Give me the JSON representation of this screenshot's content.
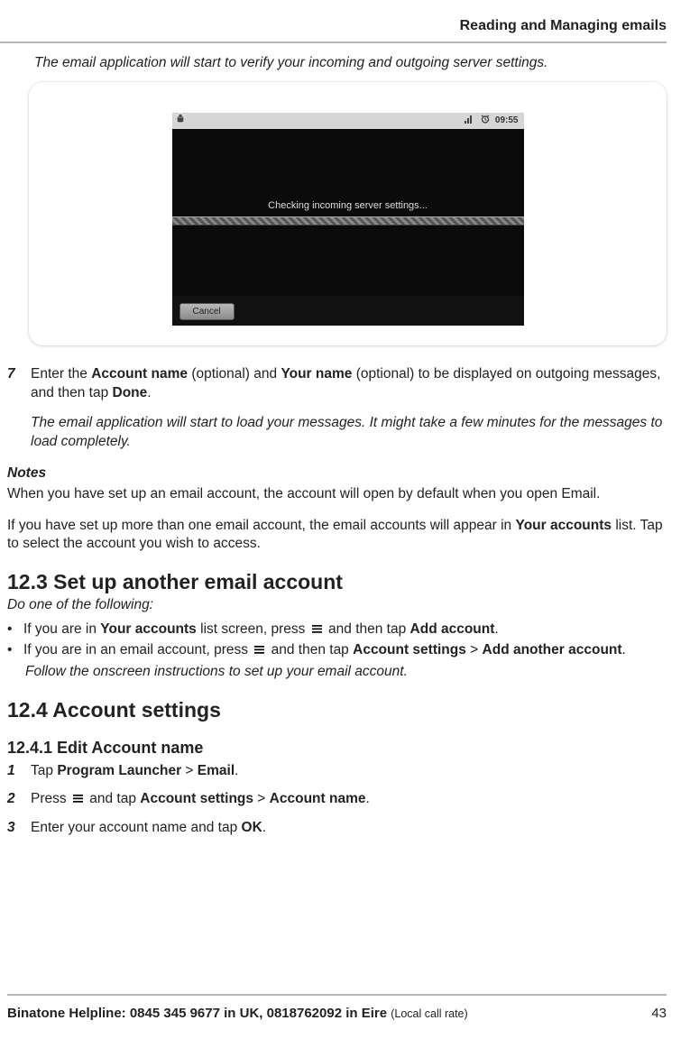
{
  "header": "Reading and Managing emails",
  "intro": "The email application will start to verify your incoming and outgoing server settings.",
  "screenshot": {
    "clock": "09:55",
    "message": "Checking incoming server settings...",
    "cancel": "Cancel"
  },
  "step7": {
    "num": "7",
    "text_pre": "Enter the ",
    "b1": "Account name",
    "text_mid1": " (optional) and ",
    "b2": "Your name",
    "text_mid2": " (optional) to be displayed on outgoing messages, and then tap ",
    "b3": "Done",
    "text_end": ".",
    "note": "The email application will start to load your messages. It might take a few minutes for the messages to load completely."
  },
  "notes": {
    "label": "Notes",
    "p1": "When you have set up an email account, the account will open by default when you open Email.",
    "p2_pre": "If you have set up more than one email account, the email accounts will appear in ",
    "p2_b": "Your accounts",
    "p2_post": " list. Tap to select the account you wish to access."
  },
  "s12_3": {
    "title": "12.3   Set up another email account",
    "sub": "Do one of the following:",
    "b1": {
      "pre": "If you are in ",
      "b1": "Your accounts",
      "mid": " list screen, press ",
      "post_pre": " and then tap ",
      "b2": "Add account",
      "end": "."
    },
    "b2": {
      "pre": "If you are in an email account, press ",
      "mid": "  and then tap ",
      "b1": "Account settings",
      "gt": " > ",
      "b2": "Add another account",
      "end": "."
    },
    "follow": "Follow the onscreen instructions to set up your email account."
  },
  "s12_4": {
    "title": "12.4   Account settings",
    "sub": "12.4.1 Edit Account name",
    "s1": {
      "num": "1",
      "pre": "Tap ",
      "b1": "Program Launcher",
      "gt": " > ",
      "b2": "Email",
      "end": "."
    },
    "s2": {
      "num": "2",
      "pre": "Press ",
      "mid": " and tap ",
      "b1": "Account settings",
      "gt": " > ",
      "b2": "Account name",
      "end": "."
    },
    "s3": {
      "num": "3",
      "pre": "Enter your account name and tap ",
      "b1": "OK",
      "end": "."
    }
  },
  "footer": {
    "line_b": "Binatone Helpline: 0845 345 9677 in UK, 0818762092 in Eire ",
    "line_n": "(Local call rate)",
    "page": "43"
  }
}
